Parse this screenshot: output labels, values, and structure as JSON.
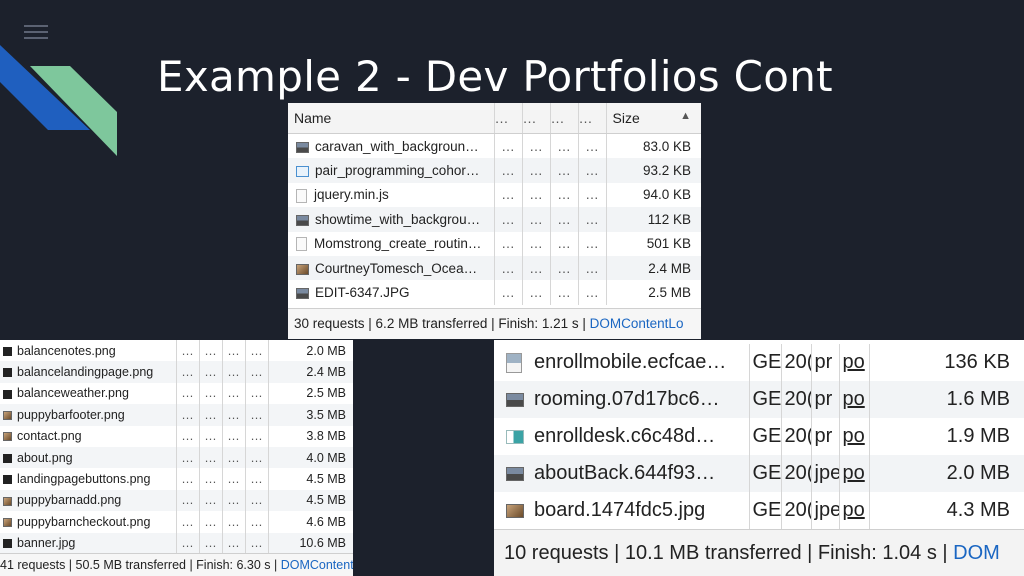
{
  "slide": {
    "title": "Example 2 - Dev Portfolios Cont",
    "colors": {
      "background": "#1c212c",
      "accent_blue": "#1f5fbf",
      "accent_green": "#7ec79c"
    }
  },
  "top_panel": {
    "columns": {
      "name": "Name",
      "dots": "…",
      "size": "Size"
    },
    "rows": [
      {
        "name": "caravan_with_backgroun…",
        "size": "83.0 KB",
        "icon": "image-icon"
      },
      {
        "name": "pair_programming_cohor…",
        "size": "93.2 KB",
        "icon": "image-icon"
      },
      {
        "name": "jquery.min.js",
        "size": "94.0 KB",
        "icon": "script-file-icon"
      },
      {
        "name": "showtime_with_backgrou…",
        "size": "112 KB",
        "icon": "image-icon"
      },
      {
        "name": "Momstrong_create_routin…",
        "size": "501 KB",
        "icon": "document-icon"
      },
      {
        "name": "CourtneyTomesch_Ocea…",
        "size": "2.4 MB",
        "icon": "image-icon"
      },
      {
        "name": "EDIT-6347.JPG",
        "size": "2.5 MB",
        "icon": "image-icon"
      }
    ],
    "status": {
      "text": "30 requests | 6.2 MB transferred | Finish: 1.21 s | ",
      "link": "DOMContentLo"
    }
  },
  "left_panel": {
    "dots": "…",
    "rows": [
      {
        "name": "balancenotes.png",
        "size": "2.0 MB"
      },
      {
        "name": "balancelandingpage.png",
        "size": "2.4 MB"
      },
      {
        "name": "balanceweather.png",
        "size": "2.5 MB"
      },
      {
        "name": "puppybarfooter.png",
        "size": "3.5 MB"
      },
      {
        "name": "contact.png",
        "size": "3.8 MB"
      },
      {
        "name": "about.png",
        "size": "4.0 MB"
      },
      {
        "name": "landingpagebuttons.png",
        "size": "4.5 MB"
      },
      {
        "name": "puppybarnadd.png",
        "size": "4.5 MB"
      },
      {
        "name": "puppybarncheckout.png",
        "size": "4.6 MB"
      },
      {
        "name": "banner.jpg",
        "size": "10.6 MB"
      }
    ],
    "status": {
      "text": "41 requests | 50.5 MB transferred | Finish: 6.30 s | ",
      "link": "DOMContentLo"
    }
  },
  "right_panel": {
    "rows": [
      {
        "name": "enrollmobile.ecfcae…",
        "method": "GE",
        "status": "20(",
        "type": "pr",
        "initiator": "po",
        "size": "136 KB"
      },
      {
        "name": "rooming.07d17bc6…",
        "method": "GE",
        "status": "20(",
        "type": "pr",
        "initiator": "po",
        "size": "1.6 MB"
      },
      {
        "name": "enrolldesk.c6c48d…",
        "method": "GE",
        "status": "20(",
        "type": "pr",
        "initiator": "po",
        "size": "1.9 MB"
      },
      {
        "name": "aboutBack.644f93…",
        "method": "GE",
        "status": "20(",
        "type": "jpe",
        "initiator": "po",
        "size": "2.0 MB"
      },
      {
        "name": "board.1474fdc5.jpg",
        "method": "GE",
        "status": "20(",
        "type": "jpe",
        "initiator": "po",
        "size": "4.3 MB"
      }
    ],
    "status": {
      "text": "10 requests | 10.1 MB transferred | Finish: 1.04 s | ",
      "link": "DOM"
    }
  }
}
